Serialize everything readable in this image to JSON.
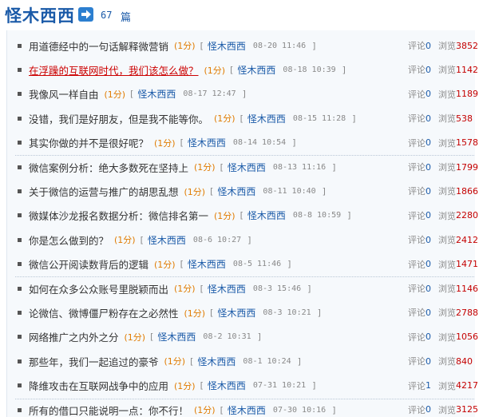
{
  "header": {
    "title": "怪木西西",
    "count": "67",
    "count_unit": "篇"
  },
  "labels": {
    "points_unit": "(1分)",
    "bracket_open": "[",
    "bracket_close": "]",
    "comment_label": "评论",
    "views_label": "浏览"
  },
  "articles": [
    {
      "title": "用道德经中的一句话解释微营销",
      "points": "(1分)",
      "author": "怪木西西",
      "date": "08-20 11:46",
      "comments": "0",
      "views": "3852",
      "highlight": false
    },
    {
      "title": "在浮躁的互联网时代，我们该怎么做？",
      "points": "(1分)",
      "author": "怪木西西",
      "date": "08-18 10:39",
      "comments": "0",
      "views": "1142",
      "highlight": true
    },
    {
      "title": "我像风一样自由",
      "points": "(1分)",
      "author": "怪木西西",
      "date": "08-17 12:47",
      "comments": "0",
      "views": "1189",
      "highlight": false
    },
    {
      "title": "没错，我们是好朋友，但是我不能等你。",
      "points": "(1分)",
      "author": "怪木西西",
      "date": "08-15 11:28",
      "comments": "0",
      "views": "538",
      "highlight": false
    },
    {
      "title": "其实你做的并不是很好呢？",
      "points": "(1分)",
      "author": "怪木西西",
      "date": "08-14 10:54",
      "comments": "0",
      "views": "1578",
      "highlight": false
    },
    {
      "title": "微信案例分析：绝大多数死在坚持上",
      "points": "(1分)",
      "author": "怪木西西",
      "date": "08-13 11:16",
      "comments": "0",
      "views": "1799",
      "highlight": false
    },
    {
      "title": "关于微信的运营与推广的胡思乱想",
      "points": "(1分)",
      "author": "怪木西西",
      "date": "08-11 10:40",
      "comments": "0",
      "views": "1866",
      "highlight": false
    },
    {
      "title": "微媒体沙龙报名数据分析：微信排名第一",
      "points": "(1分)",
      "author": "怪木西西",
      "date": "08-8 10:59",
      "comments": "0",
      "views": "2280",
      "highlight": false
    },
    {
      "title": "你是怎么做到的？",
      "points": "(1分)",
      "author": "怪木西西",
      "date": "08-6 10:27",
      "comments": "0",
      "views": "2412",
      "highlight": false
    },
    {
      "title": "微信公开阅读数背后的逻辑",
      "points": "(1分)",
      "author": "怪木西西",
      "date": "08-5 11:46",
      "comments": "0",
      "views": "1471",
      "highlight": false
    },
    {
      "title": "如何在众多公众账号里脱颖而出",
      "points": "(1分)",
      "author": "怪木西西",
      "date": "08-3 15:46",
      "comments": "0",
      "views": "1146",
      "highlight": false
    },
    {
      "title": "论微信、微博僵尸粉存在之必然性",
      "points": "(1分)",
      "author": "怪木西西",
      "date": "08-3 10:21",
      "comments": "0",
      "views": "2788",
      "highlight": false
    },
    {
      "title": "网络推广之内外之分",
      "points": "(1分)",
      "author": "怪木西西",
      "date": "08-2 10:31",
      "comments": "0",
      "views": "1056",
      "highlight": false
    },
    {
      "title": "那些年，我们一起追过的豪爷",
      "points": "(1分)",
      "author": "怪木西西",
      "date": "08-1 10:24",
      "comments": "0",
      "views": "840",
      "highlight": false
    },
    {
      "title": "降维攻击在互联网战争中的应用",
      "points": "(1分)",
      "author": "怪木西西",
      "date": "07-31 10:21",
      "comments": "1",
      "views": "4217",
      "highlight": false
    },
    {
      "title": "所有的借口只能说明一点：你不行！",
      "points": "(1分)",
      "author": "怪木西西",
      "date": "07-30 10:16",
      "comments": "0",
      "views": "3125",
      "highlight": false
    }
  ],
  "colors": {
    "brand_blue": "#1a5aa8",
    "points_orange": "#e07b00",
    "views_red": "#c40000",
    "highlight_red": "#cc0000"
  },
  "icons": {
    "header_arrow": "arrow-right-icon",
    "bullet": "square-bullet-icon"
  }
}
